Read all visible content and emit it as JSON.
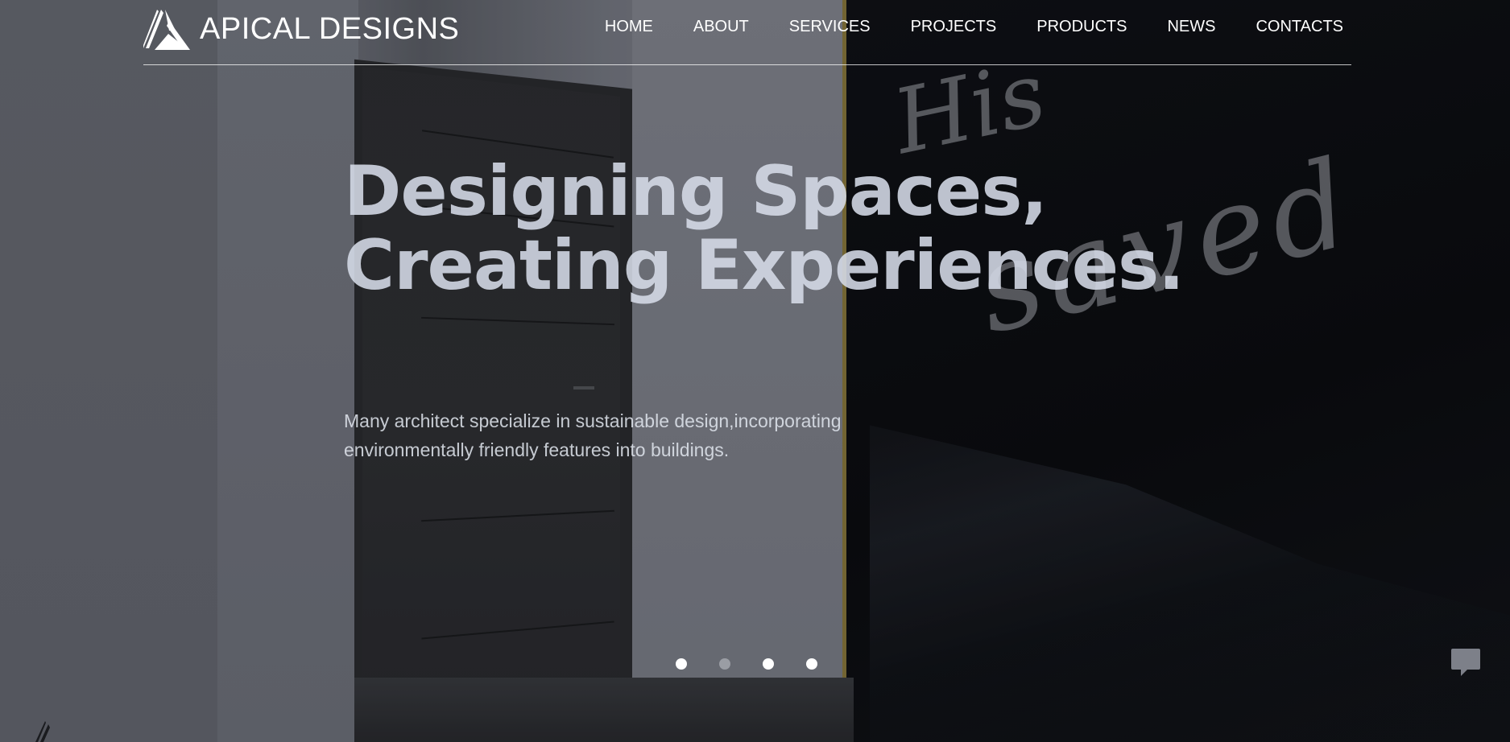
{
  "brand": {
    "name": "APICAL DESIGNS",
    "logo_icon": "triangle-logo-icon"
  },
  "nav": {
    "items": [
      {
        "label": "HOME"
      },
      {
        "label": "ABOUT"
      },
      {
        "label": "SERVICES"
      },
      {
        "label": "PROJECTS"
      },
      {
        "label": "PRODUCTS"
      },
      {
        "label": "NEWS"
      },
      {
        "label": "CONTACTS"
      }
    ]
  },
  "hero": {
    "headline_line1": "Designing Spaces,",
    "headline_line2": "Creating Experiences.",
    "subtext": "Many architect specialize in sustainable design,incorporating environmentally friendly features into buildings.",
    "artwork_text": [
      "His",
      "saved"
    ]
  },
  "slider": {
    "dots": [
      {
        "state": "active"
      },
      {
        "state": "inactive"
      },
      {
        "state": "active"
      },
      {
        "state": "active"
      }
    ]
  },
  "chat": {
    "icon": "chat-bubble-icon"
  },
  "colors": {
    "text_primary": "#ffffff",
    "headline": "#d6dce8",
    "frame_gold": "#8b7a3e"
  }
}
